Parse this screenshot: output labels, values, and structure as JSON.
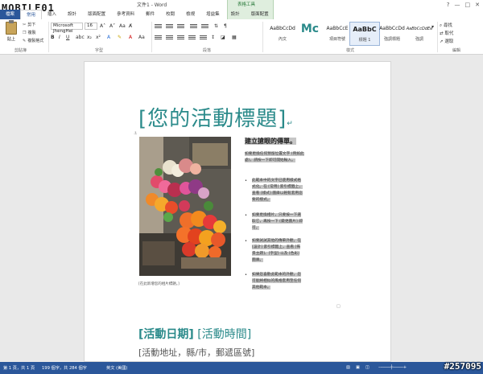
{
  "logo": {
    "text": "MOBILE01"
  },
  "window": {
    "title": "文件1 - Word",
    "context_tab": "表格工具",
    "controls": [
      "?",
      "—",
      "□",
      "✕"
    ]
  },
  "tabs": [
    "檔案",
    "常用",
    "插入",
    "設計",
    "版面配置",
    "參考資料",
    "郵件",
    "校閱",
    "檢視",
    "增益集",
    "設計",
    "版面配置"
  ],
  "ribbon": {
    "paste_label": "貼上",
    "clipboard": {
      "cut": "剪下",
      "copy": "複製",
      "format_painter": "複製格式",
      "group": "剪貼簿"
    },
    "font": {
      "name": "Microsoft JhengHei",
      "size": "16",
      "group": "字型"
    },
    "paragraph": {
      "group": "段落"
    },
    "styles": {
      "group": "樣式",
      "items": [
        {
          "preview": "AaBbCcDd",
          "label": "內文"
        },
        {
          "preview": "Mc",
          "label": ""
        },
        {
          "preview": "AaBbCcE",
          "label": "項目符號"
        },
        {
          "preview": "AaBbC",
          "label": "標題 1"
        },
        {
          "preview": "AaBbCcDd",
          "label": "強調標題"
        },
        {
          "preview": "AaBbCcDdEe",
          "label": "強調"
        }
      ]
    },
    "editing": {
      "find": "尋找",
      "replace": "取代",
      "select": "選取",
      "group": "編輯"
    }
  },
  "document": {
    "heading": "[您的活動標題]",
    "photo_caption": "[在此新增您的相片標題。]",
    "sidebar": {
      "title": "建立搶眼的傳單。",
      "intro": "如要更換任何預留位置文字 (例如此處)，請按一下即可開始輸入。",
      "bullets": [
        "此範本中的文字已使用樣式格式化。在 [常用] 索引標籤上，查看 [樣式] 圖庫以輕鬆套用您要的樣式。",
        "如要更換相片，只要按一下選取它，再按一下 [變更圖片] 即可。",
        "如要試試其他的傳單外觀，在 [設計] 索引標籤上，查看 [佈景主題]、[字型] 以及 [色彩] 圖庫。",
        "如果您喜歡此範本的外觀，您可能將相似的風格套用至任何其他範本。"
      ]
    },
    "event_date": "[活動日期]",
    "event_time": "[活動時間]",
    "event_address": "[活動地址，縣/市，郵遞區號]"
  },
  "statusbar": {
    "page": "第 1 頁，共 1 頁",
    "words": "199 個字，共 284 個字",
    "language": "英文 (美國)"
  },
  "watermark": "#257095",
  "colors": {
    "accent": "#2a8a8a",
    "word_blue": "#2b579a",
    "highlight": "#c6c6c6"
  }
}
